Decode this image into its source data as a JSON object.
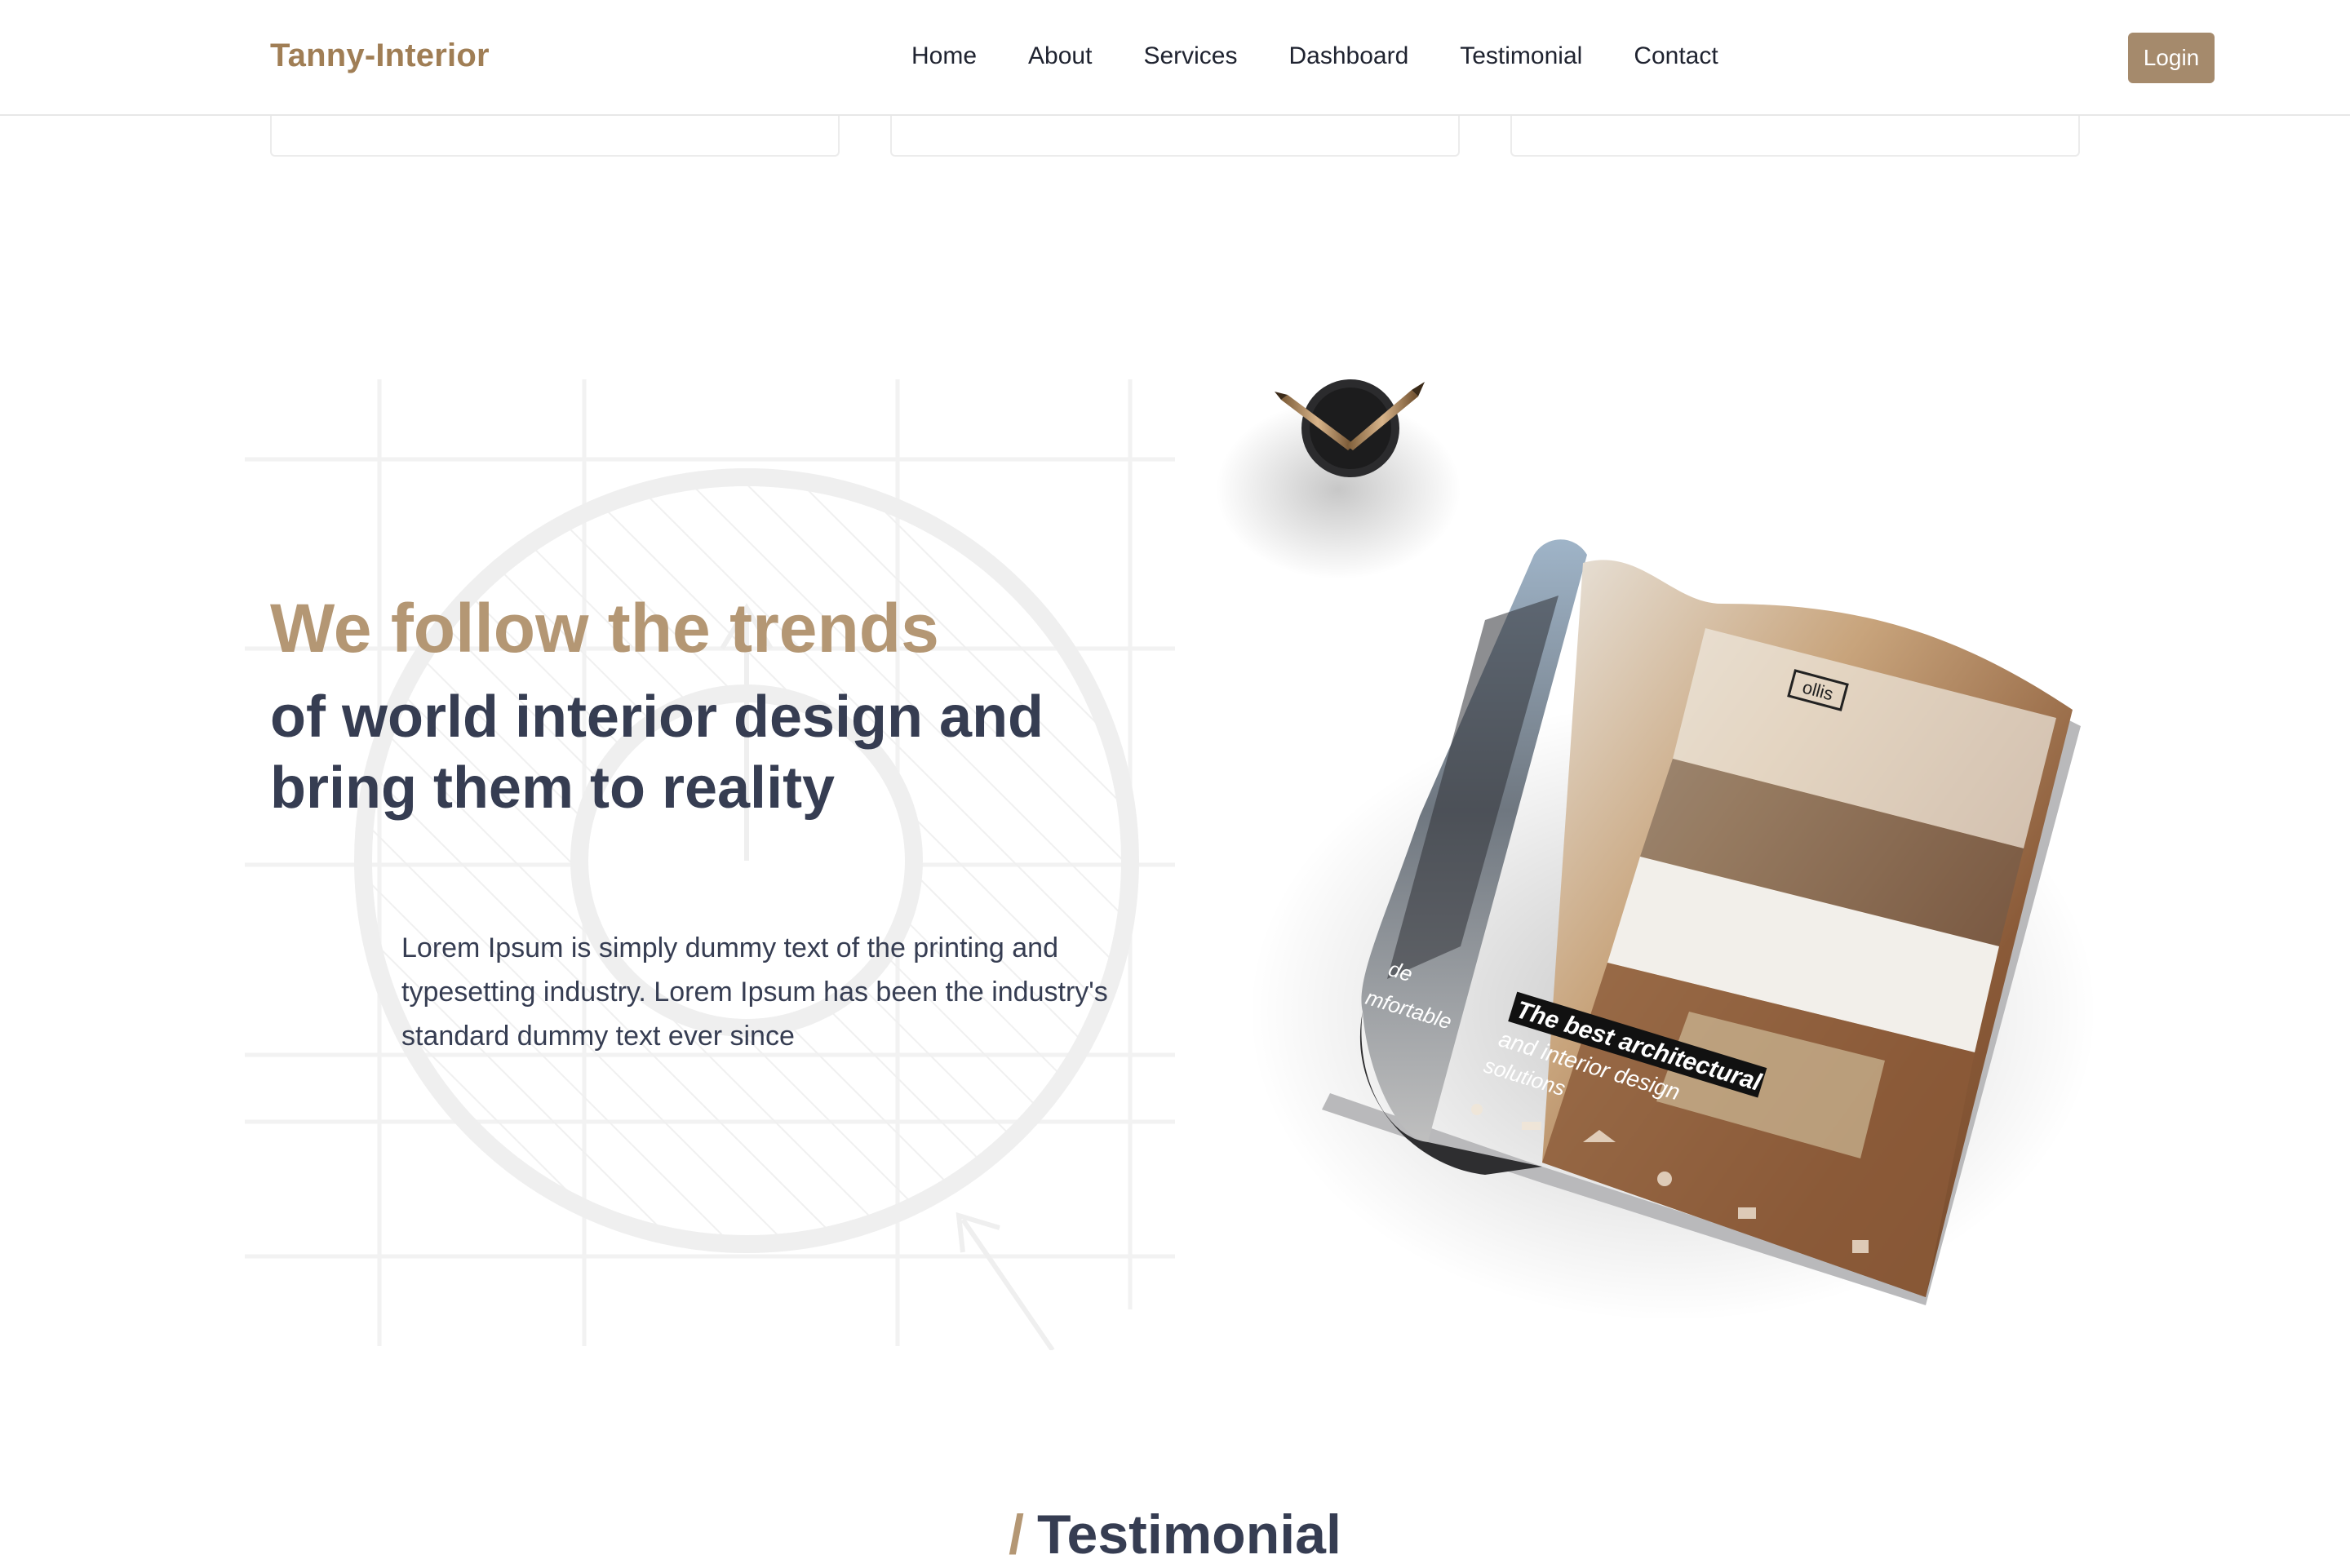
{
  "navbar": {
    "brand": "Tanny-Interior",
    "links": [
      "Home",
      "About",
      "Services",
      "Dashboard",
      "Testimonial",
      "Contact"
    ],
    "login_label": "Login"
  },
  "trends_section": {
    "heading_accent": "We follow the trends",
    "heading_main": "of world interior design and bring them to reality",
    "body": "Lorem Ipsum is simply dummy text of the printing and typesetting industry. Lorem Ipsum has been the industry's standard dummy text ever since"
  },
  "magazine": {
    "headline_line1": "The best architectural",
    "headline_line2": "and interior design",
    "headline_line3": "solutions",
    "brand_tag": "ollis",
    "side_text1": "de",
    "side_text2": "mfortable"
  },
  "testimonial_section": {
    "slash": "/",
    "title": "Testimonial"
  },
  "colors": {
    "brand": "#a07e55",
    "accent": "#b49774",
    "button": "#a58a6c",
    "heading": "#363d52"
  }
}
